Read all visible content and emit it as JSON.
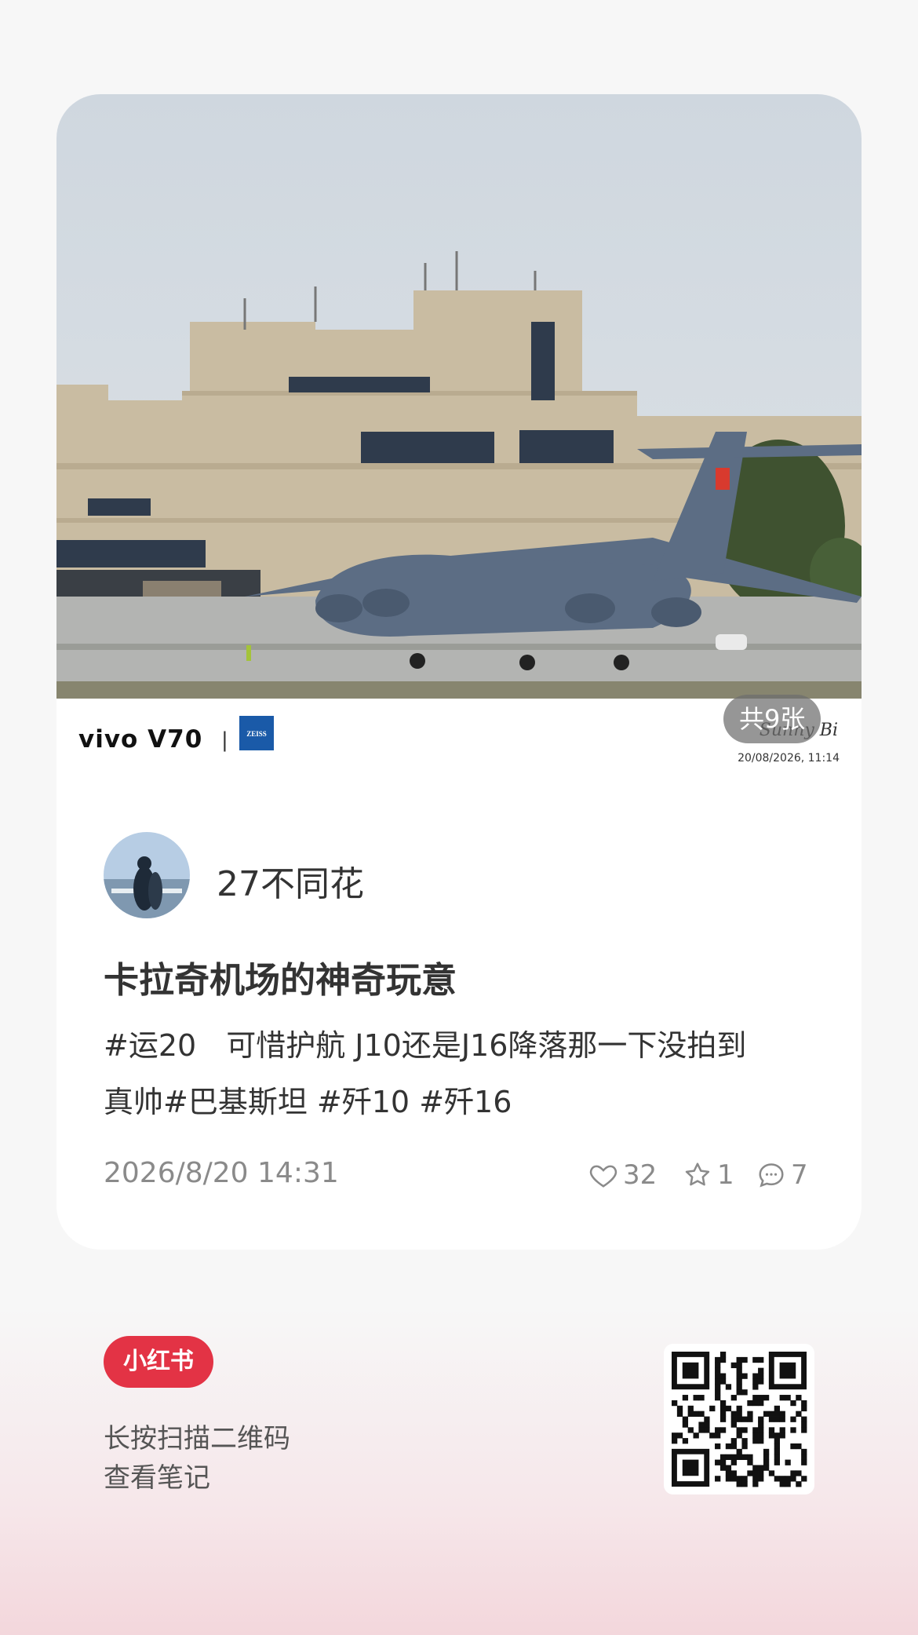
{
  "photo": {
    "camera_brand": "vivo V70",
    "lens_brand": "ZEISS",
    "signature": "Sunny Bi",
    "capture_datetime": "20/08/2026, 11:14"
  },
  "image_count_label": "共9张",
  "author": {
    "name": "27不同花"
  },
  "post": {
    "title": "卡拉奇机场的神奇玩意",
    "description_line1": "#运20　可惜护航 J10还是J16降落那一下没拍到",
    "description_line2": "真帅#巴基斯坦  #歼10  #歼16",
    "datetime": "2026/8/20 14:31",
    "likes": "32",
    "favorites": "1",
    "comments": "7"
  },
  "footer": {
    "app_logo": "小红书",
    "scan_line1": "长按扫描二维码",
    "scan_line2": "查看笔记"
  },
  "colors": {
    "brand_red": "#e33345",
    "meta_gray": "#8a8a8a"
  },
  "icons": [
    "heart-icon",
    "star-icon",
    "comment-icon",
    "qr-code-icon",
    "zeiss-logo-icon"
  ]
}
